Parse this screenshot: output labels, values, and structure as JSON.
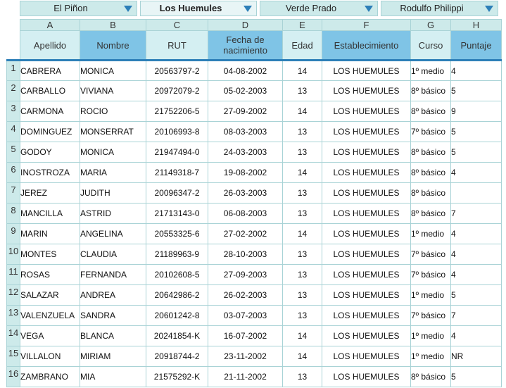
{
  "filters": [
    {
      "label": "El Piñon",
      "active": false
    },
    {
      "label": "Los Huemules",
      "active": true
    },
    {
      "label": "Verde Prado",
      "active": false
    },
    {
      "label": "Rodulfo Philippi",
      "active": false
    }
  ],
  "icons": {
    "dropdown": "triangle-down-icon",
    "color": "#2d7fb8"
  },
  "columns": {
    "letters": [
      "A",
      "B",
      "C",
      "D",
      "E",
      "F",
      "G",
      "H"
    ],
    "headers": [
      "Apellido",
      "Nombre",
      "RUT",
      "Fecha de nacimiento",
      "Edad",
      "Establecimiento",
      "Curso",
      "Puntaje"
    ]
  },
  "rows": [
    {
      "n": "1",
      "apellido": "CABRERA",
      "nombre": "MONICA",
      "rut": "20563797-2",
      "fecha": "04-08-2002",
      "edad": "14",
      "est": "LOS HUEMULES",
      "curso": "1º medio",
      "puntaje": "4"
    },
    {
      "n": "2",
      "apellido": "CARBALLO",
      "nombre": "VIVIANA",
      "rut": "20972079-2",
      "fecha": "05-02-2003",
      "edad": "13",
      "est": "LOS HUEMULES",
      "curso": "8º básico",
      "puntaje": "5"
    },
    {
      "n": "3",
      "apellido": "CARMONA",
      "nombre": "ROCIO",
      "rut": "21752206-5",
      "fecha": "27-09-2002",
      "edad": "14",
      "est": "LOS HUEMULES",
      "curso": "8º básico",
      "puntaje": "9"
    },
    {
      "n": "4",
      "apellido": "DOMINGUEZ",
      "nombre": "MONSERRAT",
      "rut": "20106993-8",
      "fecha": "08-03-2003",
      "edad": "13",
      "est": "LOS HUEMULES",
      "curso": "7º básico",
      "puntaje": "5"
    },
    {
      "n": "5",
      "apellido": "GODOY",
      "nombre": "MONICA",
      "rut": "21947494-0",
      "fecha": "24-03-2003",
      "edad": "13",
      "est": "LOS HUEMULES",
      "curso": "8º básico",
      "puntaje": "5"
    },
    {
      "n": "6",
      "apellido": "INOSTROZA",
      "nombre": "MARIA",
      "rut": "21149318-7",
      "fecha": "19-08-2002",
      "edad": "14",
      "est": "LOS HUEMULES",
      "curso": "8º básico",
      "puntaje": "4"
    },
    {
      "n": "7",
      "apellido": "JEREZ",
      "nombre": "JUDITH",
      "rut": "20096347-2",
      "fecha": "26-03-2003",
      "edad": "13",
      "est": "LOS HUEMULES",
      "curso": "8º básico",
      "puntaje": ""
    },
    {
      "n": "8",
      "apellido": "MANCILLA",
      "nombre": "ASTRID",
      "rut": "21713143-0",
      "fecha": "06-08-2003",
      "edad": "13",
      "est": "LOS HUEMULES",
      "curso": "8º básico",
      "puntaje": "7"
    },
    {
      "n": "9",
      "apellido": "MARIN",
      "nombre": "ANGELINA",
      "rut": "20553325-6",
      "fecha": "27-02-2002",
      "edad": "14",
      "est": "LOS HUEMULES",
      "curso": "1º medio",
      "puntaje": "4"
    },
    {
      "n": "10",
      "apellido": "MONTES",
      "nombre": "CLAUDIA",
      "rut": "21189963-9",
      "fecha": "28-10-2003",
      "edad": "13",
      "est": "LOS HUEMULES",
      "curso": "7º básico",
      "puntaje": "4"
    },
    {
      "n": "11",
      "apellido": "ROSAS",
      "nombre": "FERNANDA",
      "rut": "20102608-5",
      "fecha": "27-09-2003",
      "edad": "13",
      "est": "LOS HUEMULES",
      "curso": "7º básico",
      "puntaje": "4"
    },
    {
      "n": "12",
      "apellido": "SALAZAR",
      "nombre": "ANDREA",
      "rut": "20642986-2",
      "fecha": "26-02-2003",
      "edad": "13",
      "est": "LOS HUEMULES",
      "curso": "1º medio",
      "puntaje": "5"
    },
    {
      "n": "13",
      "apellido": "VALENZUELA",
      "nombre": "SANDRA",
      "rut": "20601242-8",
      "fecha": "03-07-2003",
      "edad": "13",
      "est": "LOS HUEMULES",
      "curso": "7º básico",
      "puntaje": "7"
    },
    {
      "n": "14",
      "apellido": "VEGA",
      "nombre": "BLANCA",
      "rut": "20241854-K",
      "fecha": "16-07-2002",
      "edad": "14",
      "est": "LOS HUEMULES",
      "curso": "1º medio",
      "puntaje": "4"
    },
    {
      "n": "15",
      "apellido": "VILLALON",
      "nombre": "MIRIAM",
      "rut": "20918744-2",
      "fecha": "23-11-2002",
      "edad": "14",
      "est": "LOS HUEMULES",
      "curso": "1º medio",
      "puntaje": "NR"
    },
    {
      "n": "16",
      "apellido": "ZAMBRANO",
      "nombre": "MIA",
      "rut": "21575292-K",
      "fecha": "21-11-2002",
      "edad": "13",
      "est": "LOS HUEMULES",
      "curso": "8º básico",
      "puntaje": "5"
    }
  ]
}
